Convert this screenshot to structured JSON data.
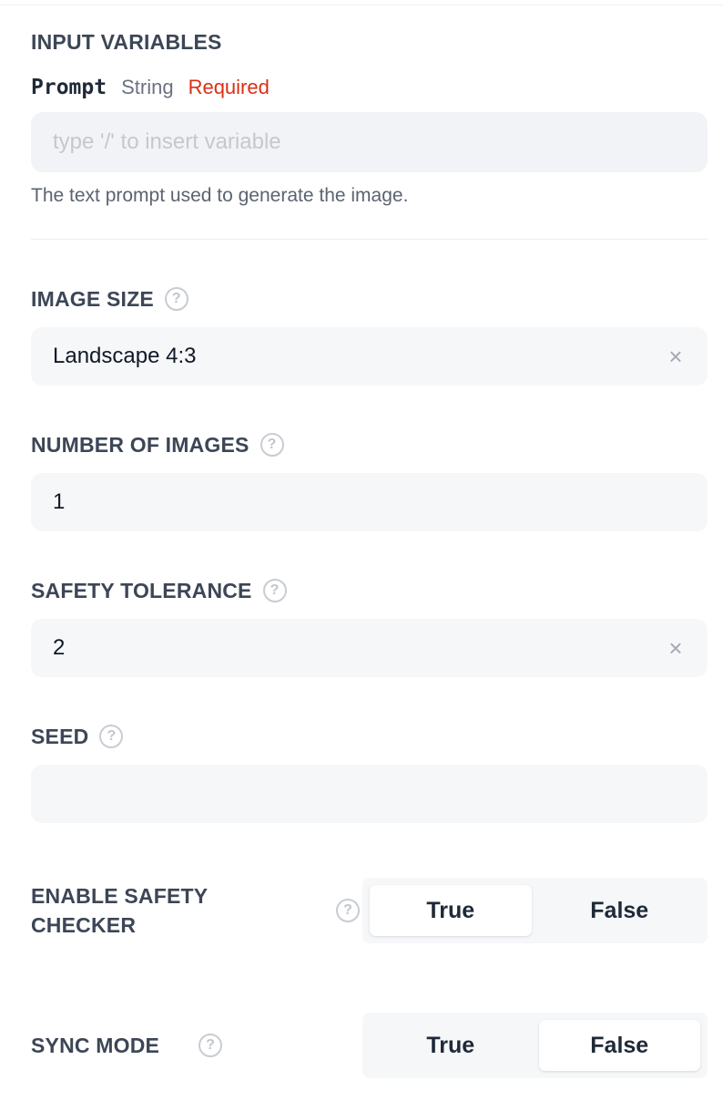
{
  "section": {
    "title": "INPUT VARIABLES"
  },
  "prompt_var": {
    "name": "Prompt",
    "type": "String",
    "required": "Required",
    "placeholder": "type '/' to insert variable",
    "value": "",
    "help": "The text prompt used to generate the image."
  },
  "fields": {
    "image_size": {
      "label": "IMAGE SIZE",
      "value": "Landscape 4:3",
      "clear_icon": "close-icon"
    },
    "num_images": {
      "label": "NUMBER OF IMAGES",
      "value": "1"
    },
    "safety_tolerance": {
      "label": "SAFETY TOLERANCE",
      "value": "2",
      "clear_icon": "close-icon"
    },
    "seed": {
      "label": "SEED",
      "value": ""
    }
  },
  "toggles": {
    "safety_checker": {
      "label_line1": "ENABLE SAFETY",
      "label_line2": "CHECKER",
      "true_label": "True",
      "false_label": "False",
      "selected": "True"
    },
    "sync_mode": {
      "label": "SYNC MODE",
      "true_label": "True",
      "false_label": "False",
      "selected": "False"
    }
  },
  "icons": {
    "help": "question-circle-icon",
    "clear": "×",
    "help_glyph": "?"
  },
  "colors": {
    "required": "#dc2f13",
    "label": "#3c4656",
    "input_bg": "#f6f7f9"
  }
}
